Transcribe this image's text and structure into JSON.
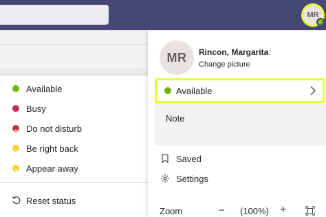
{
  "profile": {
    "initials": "MR",
    "name": "Rincon, Margarita",
    "change_picture": "Change picture"
  },
  "current_status": {
    "label": "Available",
    "color": "#6bb700"
  },
  "note": {
    "label": "Note"
  },
  "saved_label": "Saved",
  "settings_label": "Settings",
  "zoom": {
    "label": "Zoom",
    "minus": "−",
    "value": "(100%)",
    "plus": "+"
  },
  "status_menu": {
    "items": [
      {
        "label": "Available",
        "color": "#6bb700",
        "icon": "available-dot-icon"
      },
      {
        "label": "Busy",
        "color": "#c4314b",
        "icon": "busy-dot-icon"
      },
      {
        "label": "Do not disturb",
        "color": "#c4314b",
        "icon": "do-not-disturb-icon"
      },
      {
        "label": "Be right back",
        "color": "#f8d22a",
        "icon": "be-right-back-icon"
      },
      {
        "label": "Appear away",
        "color": "#f8d22a",
        "icon": "appear-away-icon"
      }
    ],
    "reset_label": "Reset status"
  },
  "colors": {
    "topbar": "#464775",
    "highlight": "#e6ff33"
  }
}
